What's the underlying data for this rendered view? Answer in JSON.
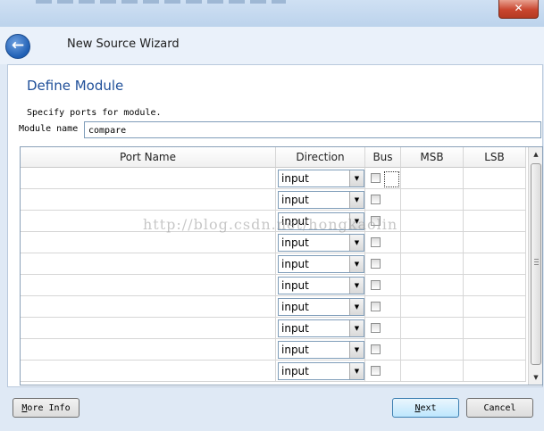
{
  "window": {
    "close_glyph": "✕"
  },
  "header": {
    "title": "New Source Wizard",
    "back_icon": "back-arrow-icon"
  },
  "page": {
    "heading": "Define Module",
    "subtitle": "Specify ports for module.",
    "module_name_label": "Module name",
    "module_name_value": "compare"
  },
  "table": {
    "columns": [
      "Port Name",
      "Direction",
      "Bus",
      "MSB",
      "LSB"
    ],
    "rows": [
      {
        "port_name": "",
        "direction": "input",
        "bus": false,
        "msb": "",
        "lsb": ""
      },
      {
        "port_name": "",
        "direction": "input",
        "bus": false,
        "msb": "",
        "lsb": ""
      },
      {
        "port_name": "",
        "direction": "input",
        "bus": false,
        "msb": "",
        "lsb": ""
      },
      {
        "port_name": "",
        "direction": "input",
        "bus": false,
        "msb": "",
        "lsb": ""
      },
      {
        "port_name": "",
        "direction": "input",
        "bus": false,
        "msb": "",
        "lsb": ""
      },
      {
        "port_name": "",
        "direction": "input",
        "bus": false,
        "msb": "",
        "lsb": ""
      },
      {
        "port_name": "",
        "direction": "input",
        "bus": false,
        "msb": "",
        "lsb": ""
      },
      {
        "port_name": "",
        "direction": "input",
        "bus": false,
        "msb": "",
        "lsb": ""
      },
      {
        "port_name": "",
        "direction": "input",
        "bus": false,
        "msb": "",
        "lsb": ""
      },
      {
        "port_name": "",
        "direction": "input",
        "bus": false,
        "msb": "",
        "lsb": ""
      }
    ]
  },
  "watermark": "http://blog.csdn.net/hongkaolin",
  "buttons": {
    "more_info": "More Info",
    "next": "Next",
    "cancel": "Cancel"
  },
  "colors": {
    "heading": "#1f4f99",
    "background": "#dfe9f5"
  }
}
